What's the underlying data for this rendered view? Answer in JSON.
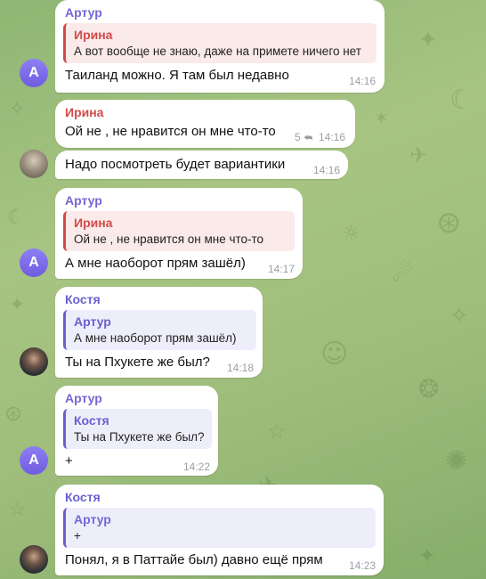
{
  "colors": {
    "artur": "#7467d4",
    "irina": "#d14a4a",
    "kostya": "#6a5fcf",
    "reply_irina_bg": "#fbeaea",
    "reply_violet_bg": "#eeeefb"
  },
  "messages": [
    {
      "sender": "Артур",
      "reply": {
        "name": "Ирина",
        "text": "А вот вообще не знаю, даже на примете ничего нет"
      },
      "text": "Таиланд можно. Я там был недавно",
      "time": "14:16",
      "avatar": "А"
    },
    {
      "sender": "Ирина",
      "text": "Ой не , не нравится он мне что-то",
      "replies_count": "5",
      "reply_icon": "reply-arrow-icon",
      "time": "14:16"
    },
    {
      "text": "Надо посмотреть будет вариантики",
      "time": "14:16",
      "avatar_icon": "user-photo-icon"
    },
    {
      "sender": "Артур",
      "reply": {
        "name": "Ирина",
        "text": "Ой не , не нравится он мне что-то"
      },
      "text": "А мне наоборот прям зашёл)",
      "time": "14:17",
      "avatar": "А"
    },
    {
      "sender": "Костя",
      "reply": {
        "name": "Артур",
        "text": "А мне наоборот прям зашёл)"
      },
      "text": "Ты на Пхукете же был?",
      "time": "14:18",
      "avatar_icon": "user-photo-icon"
    },
    {
      "sender": "Артур",
      "reply": {
        "name": "Костя",
        "text": "Ты на Пхукете же был?"
      },
      "text": "+",
      "time": "14:22",
      "avatar": "А"
    },
    {
      "sender": "Костя",
      "reply": {
        "name": "Артур",
        "text": "+"
      },
      "text": "Понял, я в Паттайе был) давно ещё прям",
      "time": "14:23",
      "avatar_icon": "user-photo-icon"
    }
  ]
}
